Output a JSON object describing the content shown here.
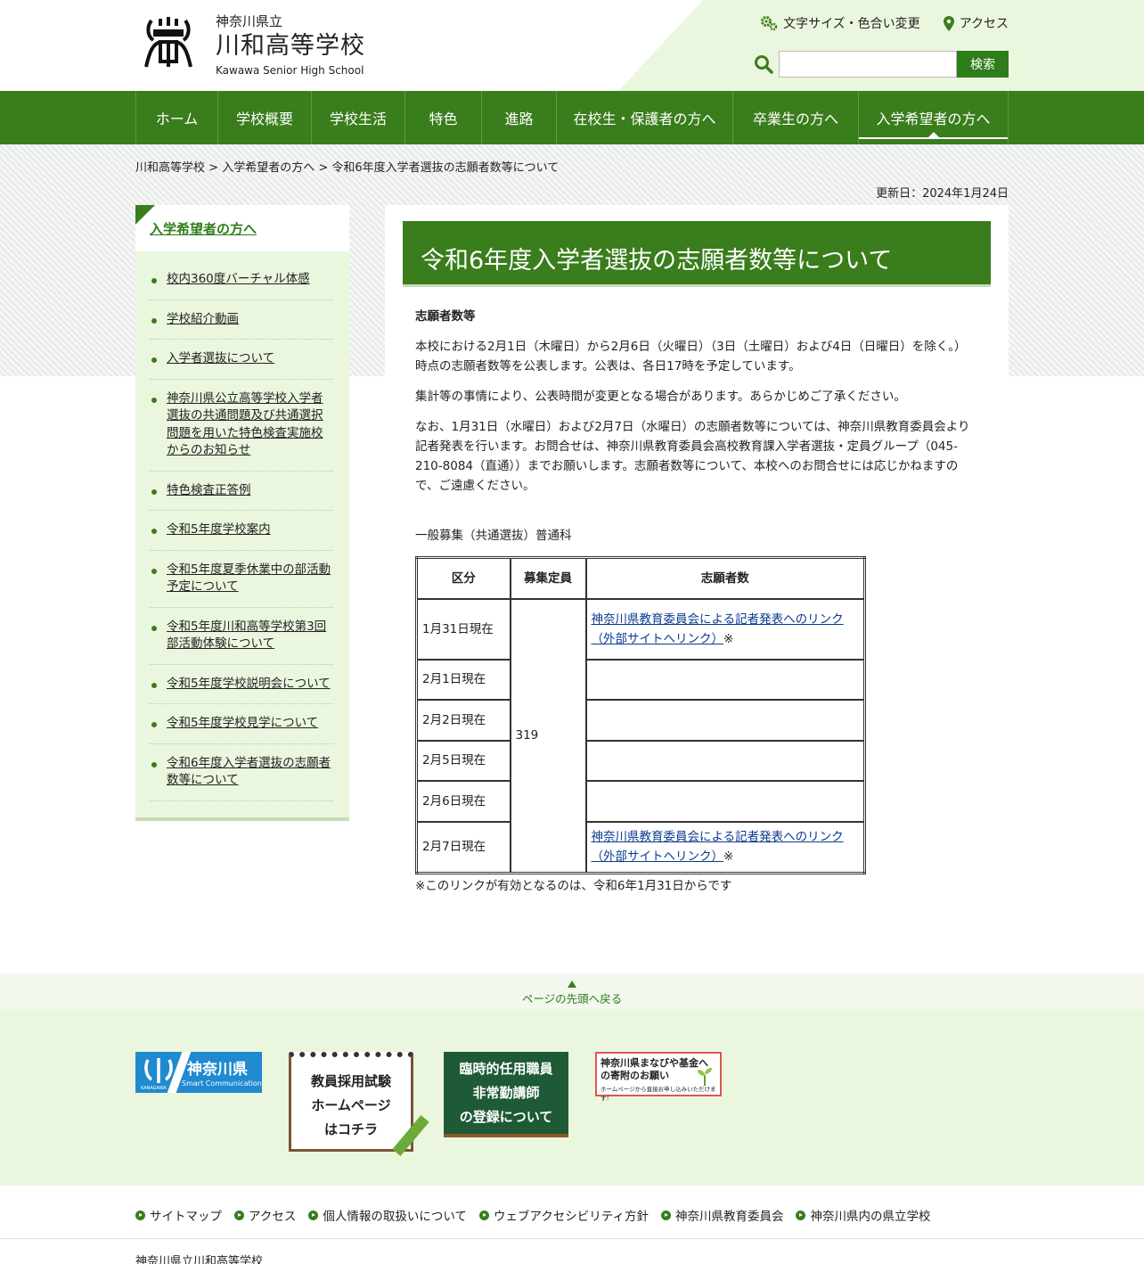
{
  "header": {
    "pref": "神奈川県立",
    "school": "川和高等学校",
    "school_en": "Kawawa Senior High School",
    "font_color_link": "文字サイズ・色合い変更",
    "access_link": "アクセス",
    "search_button": "検索",
    "search_value": ""
  },
  "nav": {
    "items": [
      {
        "label": "ホーム"
      },
      {
        "label": "学校概要"
      },
      {
        "label": "学校生活"
      },
      {
        "label": "特色"
      },
      {
        "label": "進路"
      },
      {
        "label": "在校生・保護者の方へ"
      },
      {
        "label": "卒業生の方へ"
      },
      {
        "label": "入学希望者の方へ"
      }
    ]
  },
  "breadcrumb": {
    "home": "川和高等学校",
    "sep": ">",
    "parent": "入学希望者の方へ",
    "current": "令和6年度入学者選抜の志願者数等について"
  },
  "updated": "更新日：2024年1月24日",
  "side": {
    "title": "入学希望者の方へ",
    "items": [
      {
        "label": "校内360度バーチャル体感"
      },
      {
        "label": "学校紹介動画"
      },
      {
        "label": "入学者選抜について"
      },
      {
        "label": "神奈川県公立高等学校入学者選抜の共通問題及び共通選択問題を用いた特色検査実施校からのお知らせ"
      },
      {
        "label": "特色検査正答例"
      },
      {
        "label": "令和5年度学校案内"
      },
      {
        "label": "令和5年度夏季休業中の部活動予定について"
      },
      {
        "label": "令和5年度川和高等学校第3回部活動体験について"
      },
      {
        "label": "令和5年度学校説明会について"
      },
      {
        "label": "令和5年度学校見学について"
      },
      {
        "label": "令和6年度入学者選抜の志願者数等について"
      }
    ]
  },
  "main": {
    "title": "令和6年度入学者選抜の志願者数等について",
    "h2": "志願者数等",
    "p1": "本校における2月1日（木曜日）から2月6日（火曜日）（3日（土曜日）および4日（日曜日）を除く。）時点の志願者数等を公表します。公表は、各日17時を予定しています。",
    "p2": "集計等の事情により、公表時間が変更となる場合があります。あらかじめご了承ください。",
    "p3": "なお、1月31日（水曜日）および2月7日（水曜日）の志願者数等については、神奈川県教育委員会より記者発表を行います。お問合せは、神奈川県教育委員会高校教育課入学者選抜・定員グループ（045-210-8084（直通））までお願いします。志願者数等について、本校へのお問合せには応じかねますので、ご遠慮ください。",
    "caption": "一般募集（共通選抜）普通科",
    "table": {
      "headers": [
        "区分",
        "募集定員",
        "志願者数"
      ],
      "capacity": "319",
      "link": "神奈川県教育委員会による記者発表へのリンク（外部サイトへリンク）",
      "mark": "※",
      "rows": [
        {
          "label": "1月31日現在"
        },
        {
          "label": "2月1日現在"
        },
        {
          "label": "2月2日現在"
        },
        {
          "label": "2月5日現在"
        },
        {
          "label": "2月6日現在"
        },
        {
          "label": "2月7日現在"
        }
      ]
    },
    "note": "※このリンクが有効となるのは、令和6年1月31日からです"
  },
  "totop": "ページの先頭へ戻る",
  "banners": {
    "kanagawa_title": "神奈川県",
    "kanagawa_sub": "Smart Communication",
    "kanagawa_logo_sub": "KANAGAWA",
    "teacher_exam": [
      "教員採用試験",
      "ホームページ",
      "はコチラ"
    ],
    "temp_staff": [
      "臨時的任用職員",
      "非常勤講師",
      "の登録について"
    ],
    "fund_title": "神奈川県まなびや基金への寄附のお願い",
    "fund_sub": "ホームページから直接お申し込みいただけます！"
  },
  "footer_links": [
    {
      "label": "サイトマップ"
    },
    {
      "label": "アクセス"
    },
    {
      "label": "個人情報の取扱いについて"
    },
    {
      "label": "ウェブアクセシビリティ方針"
    },
    {
      "label": "神奈川県教育委員会"
    },
    {
      "label": "神奈川県内の県立学校"
    }
  ],
  "footer_name": "神奈川県立川和高等学校"
}
